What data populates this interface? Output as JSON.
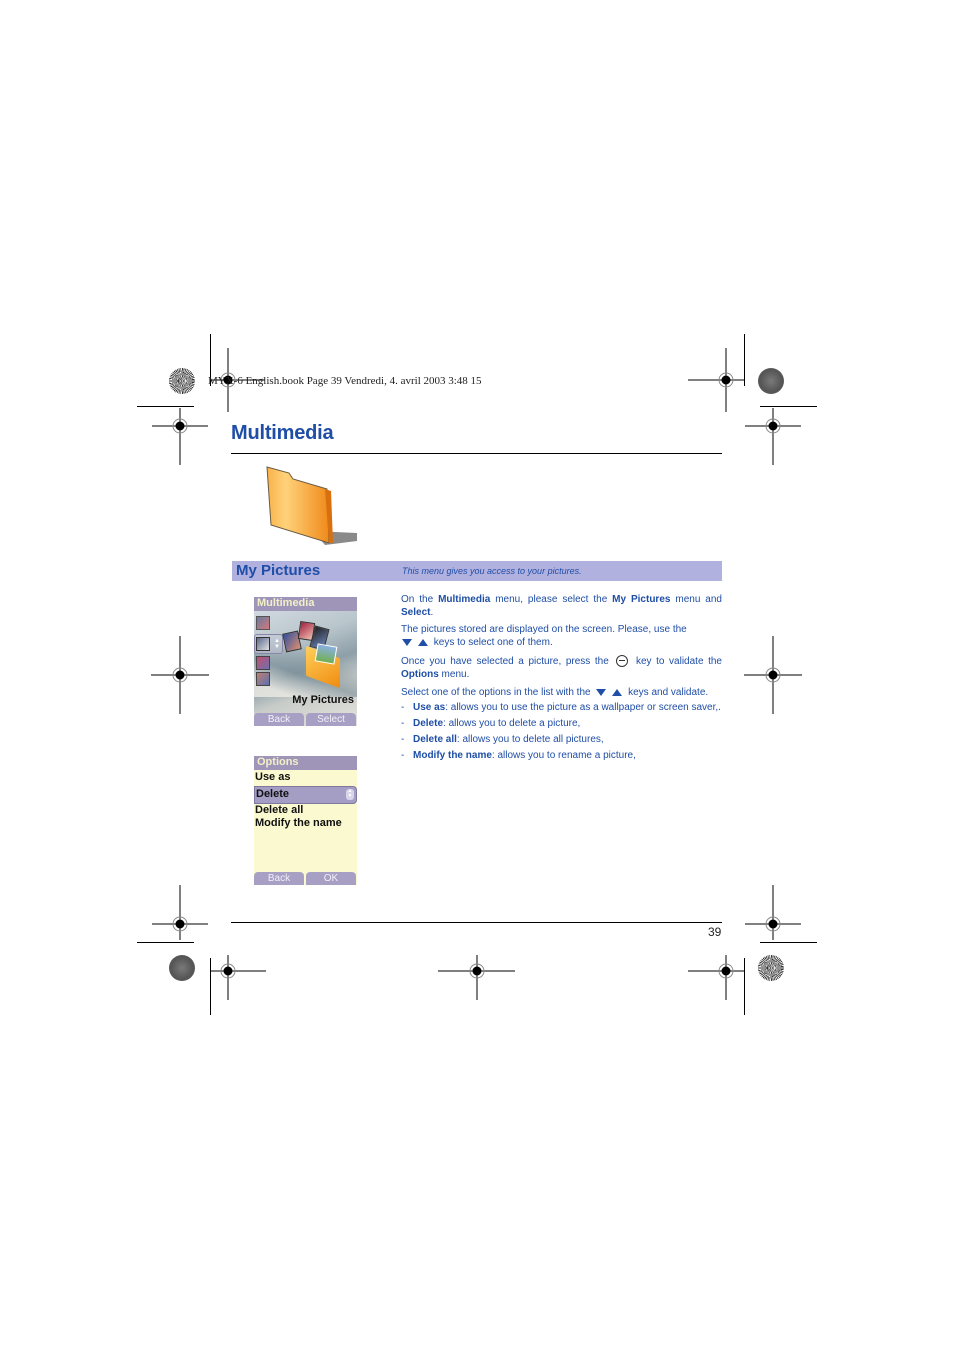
{
  "print_header": "MYX-6 English.book  Page 39  Vendredi, 4. avril 2003  3:48 15",
  "page_title": "Multimedia",
  "section": {
    "title": "My Pictures",
    "description": "This menu gives you access to your pictures."
  },
  "phone_screen_menu": {
    "title": "Multimedia",
    "selected_label": "My Pictures",
    "soft_left": "Back",
    "soft_right": "Select"
  },
  "phone_screen_options": {
    "title": "Options",
    "items": [
      "Use as",
      "Delete",
      "Delete all",
      "Modify the name"
    ],
    "selected_item": "Delete",
    "soft_left": "Back",
    "soft_right": "OK"
  },
  "body": {
    "p1": {
      "t1": "On the ",
      "b1": "Multimedia",
      "t2": " menu, please select the ",
      "b2": "My Pictures",
      "t3": " menu and ",
      "b3": "Select",
      "t4": "."
    },
    "p2": {
      "t1": "The pictures stored are displayed on the screen. Please, use the",
      "t2": " keys to select one of them."
    },
    "p3": {
      "t1": "Once you have selected a picture, press the",
      "t2": " key to validate the ",
      "b1": "Options",
      "t3": " menu."
    },
    "p4": {
      "t1": "Select one of the options in the list with the",
      "t2": " keys and validate."
    },
    "bullets": [
      {
        "term": "Use as",
        "text": ": allows you to use the picture as a wallpaper or screen saver,."
      },
      {
        "term": "Delete",
        "text": ": allows you to delete a picture,"
      },
      {
        "term": "Delete all",
        "text": ": allows you to delete all pictures,"
      },
      {
        "term": "Modify the name",
        "text": ": allows you to rename a picture,"
      }
    ]
  },
  "page_number": "39",
  "icons": {
    "down_key": "down-triangle",
    "up_key": "up-triangle",
    "ok_key": "center-key"
  },
  "colors": {
    "accent_blue": "#1f4ea6",
    "section_bar": "#b1b1e0",
    "screen_title_bar": "#9e95b8",
    "options_background": "#fbf9cf"
  }
}
